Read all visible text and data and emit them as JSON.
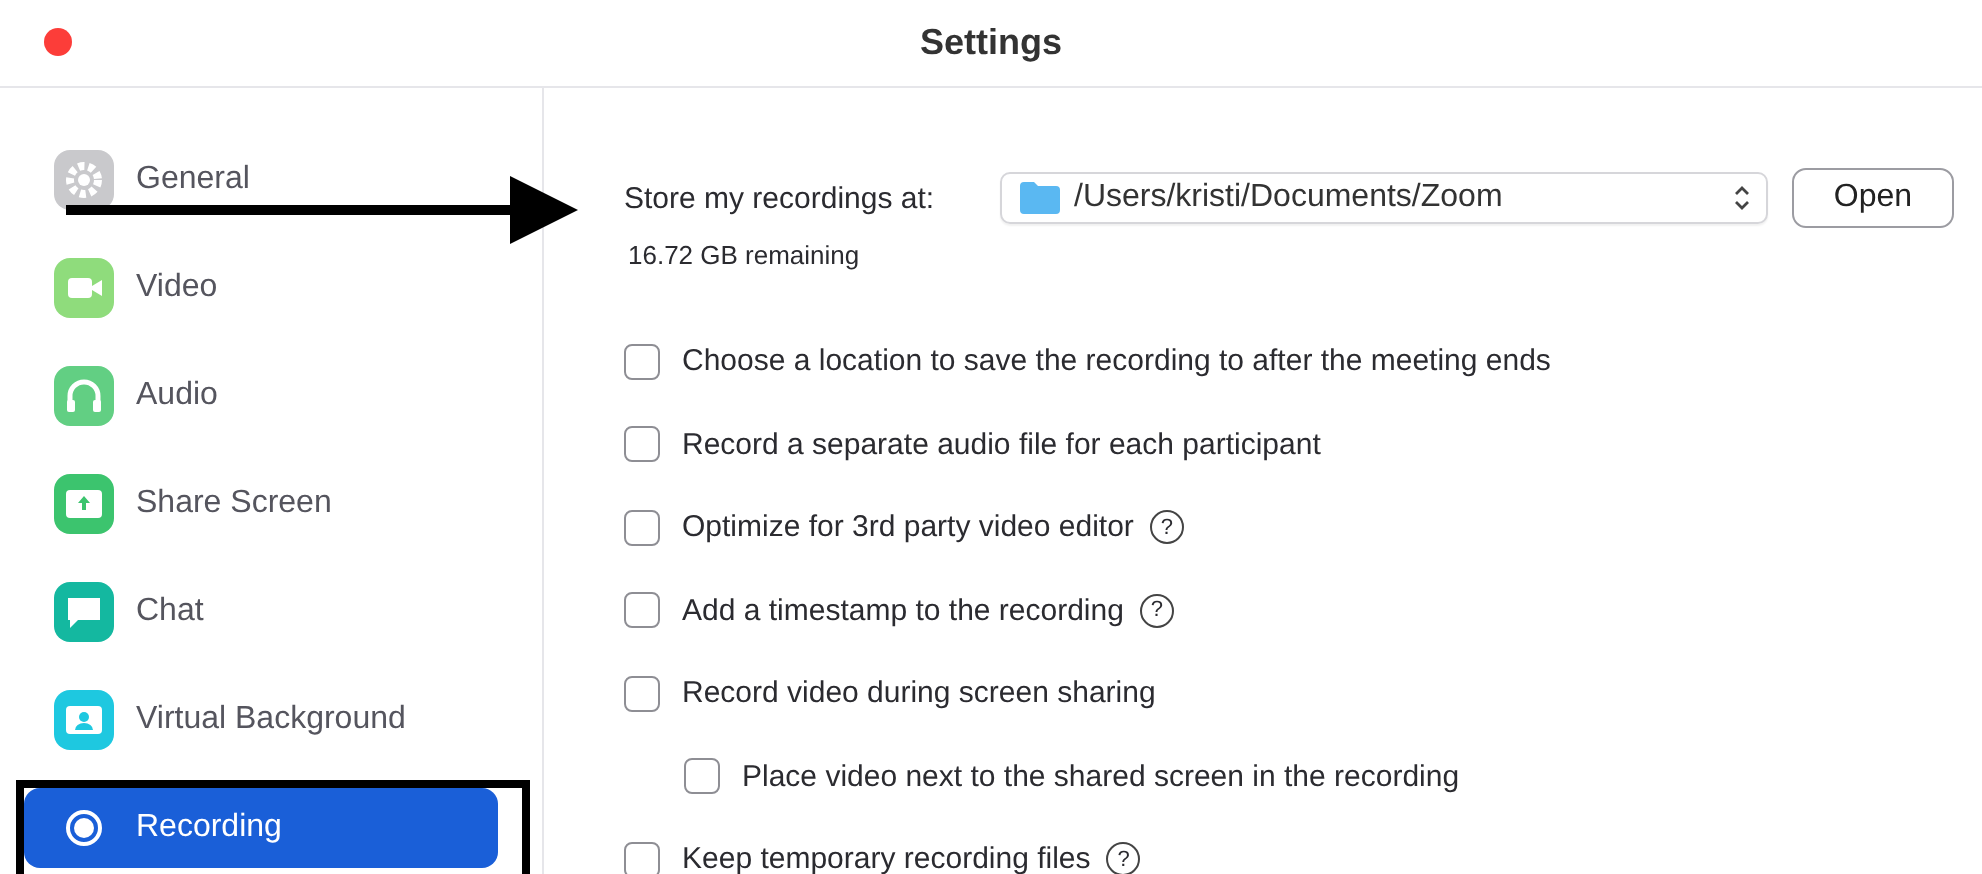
{
  "window": {
    "title": "Settings"
  },
  "sidebar": {
    "items": [
      {
        "label": "General",
        "kind": "gear",
        "color": "#c9c9cc",
        "selected": false
      },
      {
        "label": "Video",
        "kind": "camera",
        "color": "#8fdc7c",
        "selected": false
      },
      {
        "label": "Audio",
        "kind": "headphones",
        "color": "#62cf83",
        "selected": false
      },
      {
        "label": "Share Screen",
        "kind": "share",
        "color": "#3cc46e",
        "selected": false
      },
      {
        "label": "Chat",
        "kind": "chat",
        "color": "#14b8a0",
        "selected": false
      },
      {
        "label": "Virtual Background",
        "kind": "person",
        "color": "#1ec8e0",
        "selected": false
      },
      {
        "label": "Recording",
        "kind": "record",
        "color": "#ffffff",
        "selected": true
      }
    ]
  },
  "storage": {
    "label": "Store my recordings at:",
    "path": "/Users/kristi/Documents/Zoom",
    "open_button": "Open",
    "remaining": "16.72 GB remaining"
  },
  "options": [
    {
      "label": "Choose a location to save the recording to after the meeting ends",
      "checked": false
    },
    {
      "label": "Record a separate audio file for each participant",
      "checked": false
    },
    {
      "label": "Optimize for 3rd party video editor",
      "checked": false,
      "help": "?"
    },
    {
      "label": "Add a timestamp to the recording",
      "checked": false,
      "help": "?"
    },
    {
      "label": "Record video during screen sharing",
      "checked": false,
      "children": [
        {
          "label": "Place video next to the shared screen in the recording",
          "checked": false
        }
      ]
    },
    {
      "label": "Keep temporary recording files",
      "checked": false,
      "help": "?"
    }
  ]
}
